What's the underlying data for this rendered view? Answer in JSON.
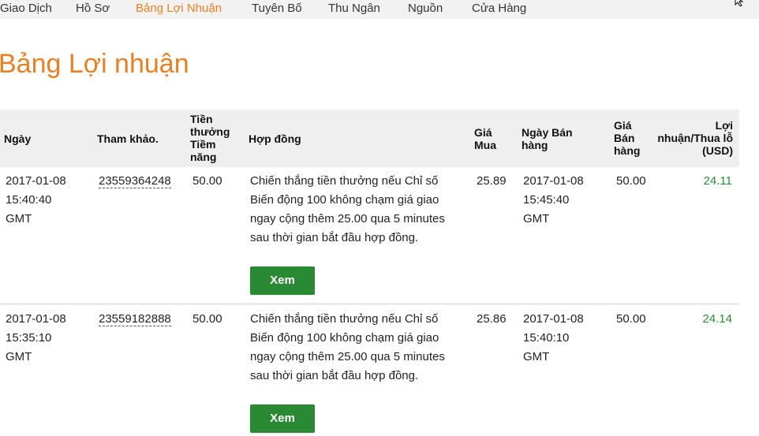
{
  "nav": {
    "items": [
      {
        "label": "Giao Dịch",
        "active": false
      },
      {
        "label": "Hồ Sơ",
        "active": false
      },
      {
        "label": "Bảng Lợi Nhuận",
        "active": true
      },
      {
        "label": "Tuyên Bố",
        "active": false
      },
      {
        "label": "Thu Ngân",
        "active": false
      },
      {
        "label": "Nguồn",
        "active": false
      },
      {
        "label": "Cửa Hàng",
        "active": false
      }
    ],
    "active_color": "#e98024"
  },
  "page": {
    "title": "Bảng Lợi nhuận",
    "title_color": "#e98024"
  },
  "table": {
    "headers": {
      "date": "Ngày",
      "ref": "Tham khảo.",
      "payout": "Tiền thưởng Tiềm năng",
      "contract": "Hợp đồng",
      "buy_price": "Giá Mua",
      "sell_date": "Ngày Bán hàng",
      "sell_price": "Giá Bán hàng",
      "profit": "Lợi nhuận/Thua lỗ (USD)"
    },
    "rows": [
      {
        "date": "2017-01-08 15:40:40 GMT",
        "ref": "23559364248",
        "payout": "50.00",
        "contract": "Chiến thắng tiền thưởng nếu Chỉ số Biến động 100 không chạm giá giao ngay cộng thêm 25.00 qua 5 minutes sau thời gian bắt đầu hợp đồng.",
        "view_label": "Xem",
        "buy_price": "25.89",
        "sell_date": "2017-01-08 15:45:40 GMT",
        "sell_price": "50.00",
        "profit": "24.11"
      },
      {
        "date": "2017-01-08 15:35:10 GMT",
        "ref": "23559182888",
        "payout": "50.00",
        "contract": "Chiến thắng tiền thưởng nếu Chỉ số Biến động 100 không chạm giá giao ngay cộng thêm 25.00 qua 5 minutes sau thời gian bắt đầu hợp đồng.",
        "view_label": "Xem",
        "buy_price": "25.86",
        "sell_date": "2017-01-08 15:40:10 GMT",
        "sell_price": "50.00",
        "profit": "24.14"
      }
    ],
    "profit_color": "#2e8b37",
    "button_color": "#2a8a33"
  }
}
